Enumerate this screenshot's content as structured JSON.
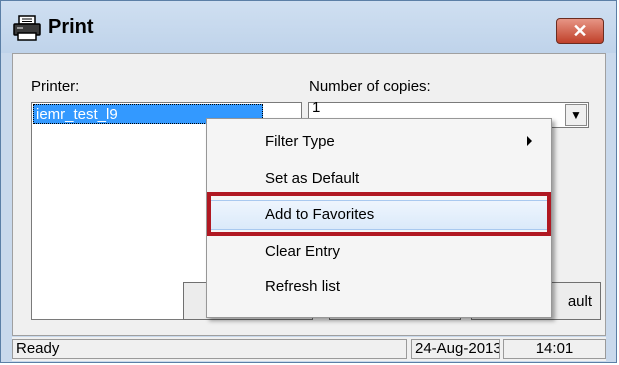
{
  "window": {
    "title": "Print",
    "title_icon": "printer-icon",
    "close_glyph": "✕"
  },
  "printer": {
    "label": "Printer:",
    "selected": "iemr_test_l9"
  },
  "copies": {
    "label": "Number of copies:",
    "value": "1"
  },
  "buttons": {
    "right_button_partial": "ault"
  },
  "status": {
    "text": "Ready",
    "date": "24-Aug-2013",
    "time": "14:01"
  },
  "context_menu": {
    "items": [
      {
        "label": "Filter Type",
        "has_submenu": true
      },
      {
        "label": "Set as Default",
        "has_submenu": false
      },
      {
        "label": "Add to Favorites",
        "has_submenu": false
      },
      {
        "label": "Clear Entry",
        "has_submenu": false
      },
      {
        "label": "Refresh list",
        "has_submenu": false
      }
    ],
    "highlighted_index": 2
  },
  "colors": {
    "selection": "#3399ff",
    "highlight_outline": "#b01822",
    "close_button": "#c0402a"
  }
}
